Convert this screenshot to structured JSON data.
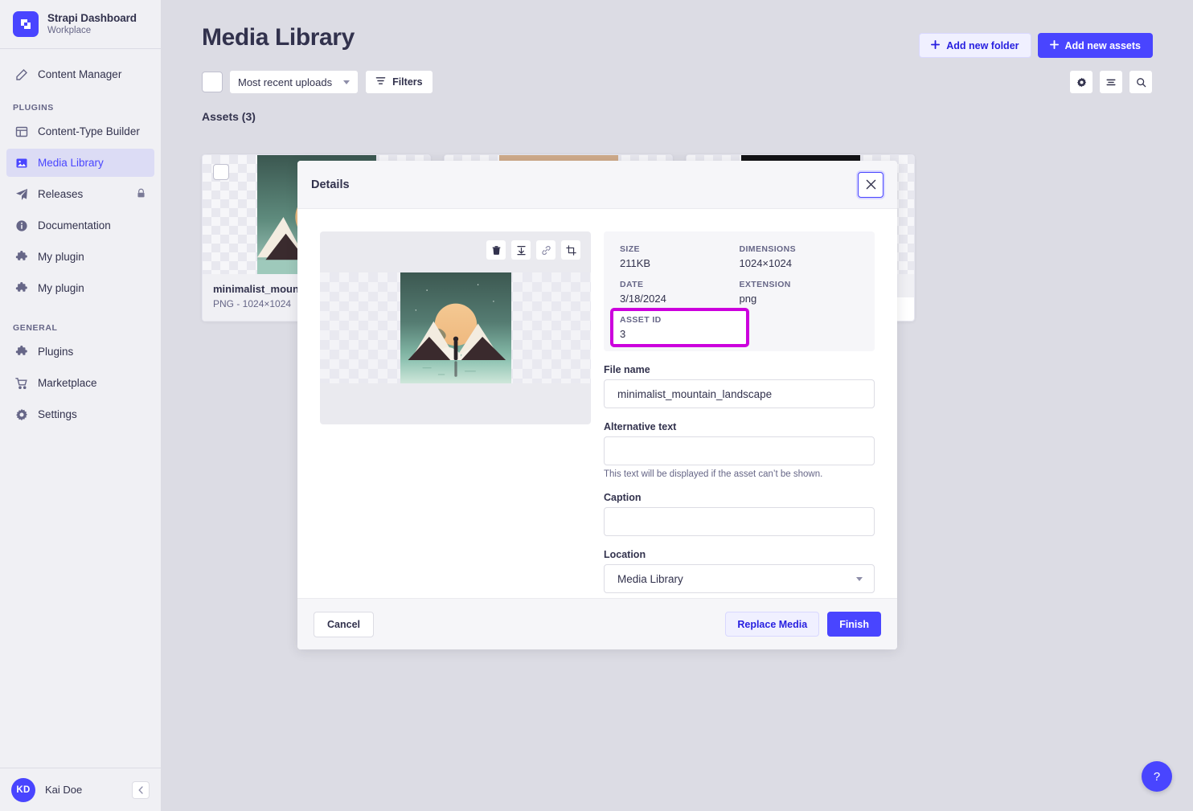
{
  "brand": {
    "title": "Strapi Dashboard",
    "subtitle": "Workplace",
    "logo_color": "#4945ff"
  },
  "sidebar": {
    "top_items": [
      {
        "label": "Content Manager",
        "icon": "pencil-icon"
      }
    ],
    "plugins_label": "PLUGINS",
    "plugins": [
      {
        "label": "Content-Type Builder",
        "icon": "layout-icon",
        "active": false,
        "locked": false
      },
      {
        "label": "Media Library",
        "icon": "image-icon",
        "active": true,
        "locked": false
      },
      {
        "label": "Releases",
        "icon": "paper-plane-icon",
        "active": false,
        "locked": true
      },
      {
        "label": "Documentation",
        "icon": "info-icon",
        "active": false,
        "locked": false
      },
      {
        "label": "My plugin",
        "icon": "puzzle-icon",
        "active": false,
        "locked": false
      },
      {
        "label": "My plugin",
        "icon": "puzzle-icon",
        "active": false,
        "locked": false
      }
    ],
    "general_label": "GENERAL",
    "general": [
      {
        "label": "Plugins",
        "icon": "puzzle-icon"
      },
      {
        "label": "Marketplace",
        "icon": "cart-icon"
      },
      {
        "label": "Settings",
        "icon": "gear-icon"
      }
    ],
    "user": {
      "initials": "KD",
      "name": "Kai Doe",
      "collapse_icon": "chevron-left-icon"
    }
  },
  "header": {
    "title": "Media Library",
    "add_folder_label": "Add new folder",
    "add_assets_label": "Add new assets"
  },
  "toolbar": {
    "sort_value": "Most recent uploads",
    "filters_label": "Filters",
    "settings_icon": "gear-icon",
    "list_icon": "list-view-icon",
    "search_icon": "search-icon"
  },
  "assets": {
    "section_label": "Assets (3)",
    "items": [
      {
        "name": "minimalist_mountain_landscape",
        "subtitle": "PNG - 1024×1024",
        "art": "mountain"
      },
      {
        "name": "",
        "subtitle": "",
        "art": "tan"
      },
      {
        "name": "",
        "subtitle": "",
        "art": "black"
      }
    ]
  },
  "modal": {
    "title": "Details",
    "close_icon": "close-icon",
    "preview_tools": [
      {
        "name": "delete-icon",
        "label": "Delete"
      },
      {
        "name": "download-icon",
        "label": "Download"
      },
      {
        "name": "link-icon",
        "label": "Copy link"
      },
      {
        "name": "crop-icon",
        "label": "Crop"
      }
    ],
    "meta": [
      {
        "key": "SIZE",
        "value": "211KB",
        "highlight": false
      },
      {
        "key": "DIMENSIONS",
        "value": "1024×1024",
        "highlight": false
      },
      {
        "key": "DATE",
        "value": "3/18/2024",
        "highlight": false
      },
      {
        "key": "EXTENSION",
        "value": "png",
        "highlight": false
      },
      {
        "key": "ASSET ID",
        "value": "3",
        "highlight": true
      }
    ],
    "highlight_color": "#cc00dd",
    "fields": {
      "file_name_label": "File name",
      "file_name_value": "minimalist_mountain_landscape",
      "alt_label": "Alternative text",
      "alt_value": "",
      "alt_placeholder": "",
      "alt_hint": "This text will be displayed if the asset can’t be shown.",
      "caption_label": "Caption",
      "caption_value": "",
      "caption_placeholder": "",
      "location_label": "Location",
      "location_value": "Media Library"
    },
    "footer": {
      "cancel_label": "Cancel",
      "replace_label": "Replace Media",
      "finish_label": "Finish"
    }
  },
  "help": {
    "icon": "question-mark-icon",
    "label": "?"
  }
}
